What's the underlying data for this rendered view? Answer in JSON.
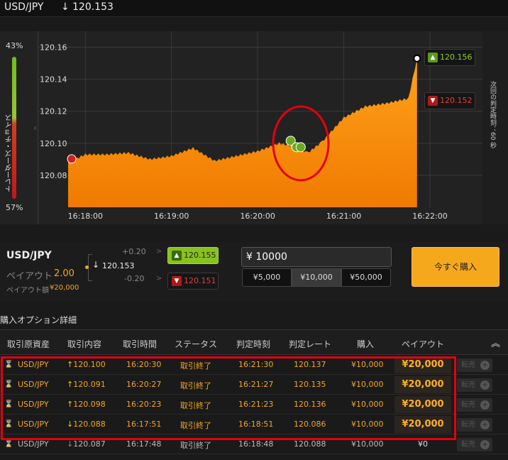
{
  "header": {
    "pair": "USD/JPY",
    "direction": "↓",
    "rate": "120.153"
  },
  "chart": {
    "traders_choice_label": "トレーダーズ・チョイス",
    "pct_top": "43%",
    "pct_bottom": "57%",
    "timer_label": "次回の判定時刻：60 秒",
    "high_box": {
      "icon": "up-arrow-icon",
      "rate": "120.156"
    },
    "low_box": {
      "icon": "down-arrow-icon",
      "rate": "120.152"
    }
  },
  "chart_data": {
    "type": "area",
    "x_ticks": [
      "16:18:00",
      "16:19:00",
      "16:20:00",
      "16:21:00",
      "16:22:00"
    ],
    "y_ticks": [
      "120.08",
      "120.10",
      "120.12",
      "120.14",
      "120.16"
    ],
    "ylim": [
      120.06,
      120.17
    ],
    "xlim": [
      "16:17:48",
      "16:22:00"
    ],
    "grid": true,
    "x": [
      "16:17:48",
      "16:18:00",
      "16:18:15",
      "16:18:30",
      "16:18:45",
      "16:19:00",
      "16:19:15",
      "16:19:30",
      "16:19:45",
      "16:20:00",
      "16:20:15",
      "16:20:25",
      "16:20:35",
      "16:20:45",
      "16:21:00",
      "16:21:15",
      "16:21:30",
      "16:21:45",
      "16:21:51"
    ],
    "y": [
      120.088,
      120.093,
      120.093,
      120.094,
      120.09,
      120.092,
      120.097,
      120.089,
      120.092,
      120.095,
      120.1,
      120.098,
      120.094,
      120.101,
      120.116,
      120.123,
      120.125,
      120.128,
      120.153
    ],
    "markers": [
      {
        "time": "16:17:51",
        "direction": "low"
      },
      {
        "time": "16:20:23",
        "direction": "high"
      },
      {
        "time": "16:20:27",
        "direction": "high"
      },
      {
        "time": "16:20:30",
        "direction": "high"
      }
    ],
    "colors": {
      "fill_top": "#ffa21a",
      "fill_bottom": "#f07a00",
      "circle": "#e3000f"
    }
  },
  "trade": {
    "pair": "USD/JPY",
    "payout_label": "ペイアウト",
    "payout_value": "2.00",
    "payout_amount_label": "ペイアウト額",
    "payout_amount": "¥20,000",
    "offset_plus": "+0.20",
    "offset_minus": "-0.20",
    "arrow": "↓",
    "current_rate": "120.153",
    "gt": ">",
    "high_rate": "120.155",
    "low_rate": "120.151",
    "amount_value": "¥ 10000",
    "presets": [
      "¥5,000",
      "¥10,000",
      "¥50,000"
    ],
    "buy_now": "今すぐ購入"
  },
  "details": {
    "title": "購入オプション詳細",
    "headers": [
      "取引原資産",
      "取引内容",
      "取引時間",
      "ステータス",
      "判定時刻",
      "判定レート",
      "購入",
      "ペイアウト"
    ],
    "collapse_icon": "︽",
    "sell_label": "転売",
    "rows": [
      {
        "asset": "USD/JPY",
        "dir": "↑",
        "rate": "120.100",
        "time": "16:20:30",
        "status": "取引終了",
        "expiry": "16:21:30",
        "expiry_rate": "120.137",
        "amount": "¥10,000",
        "payout": "¥20,000",
        "state": "active"
      },
      {
        "asset": "USD/JPY",
        "dir": "↑",
        "rate": "120.091",
        "time": "16:20:27",
        "status": "取引終了",
        "expiry": "16:21:27",
        "expiry_rate": "120.135",
        "amount": "¥10,000",
        "payout": "¥20,000",
        "state": "active"
      },
      {
        "asset": "USD/JPY",
        "dir": "↑",
        "rate": "120.098",
        "time": "16:20:23",
        "status": "取引終了",
        "expiry": "16:21:23",
        "expiry_rate": "120.136",
        "amount": "¥10,000",
        "payout": "¥20,000",
        "state": "active"
      },
      {
        "asset": "USD/JPY",
        "dir": "↓",
        "rate": "120.088",
        "time": "16:17:51",
        "status": "取引終了",
        "expiry": "16:18:51",
        "expiry_rate": "120.086",
        "amount": "¥10,000",
        "payout": "¥20,000",
        "state": "active"
      },
      {
        "asset": "USD/JPY",
        "dir": "↓",
        "rate": "120.087",
        "time": "16:17:48",
        "status": "取引終了",
        "expiry": "16:18:48",
        "expiry_rate": "120.088",
        "amount": "¥10,000",
        "payout": "¥0",
        "state": "expired"
      }
    ]
  }
}
